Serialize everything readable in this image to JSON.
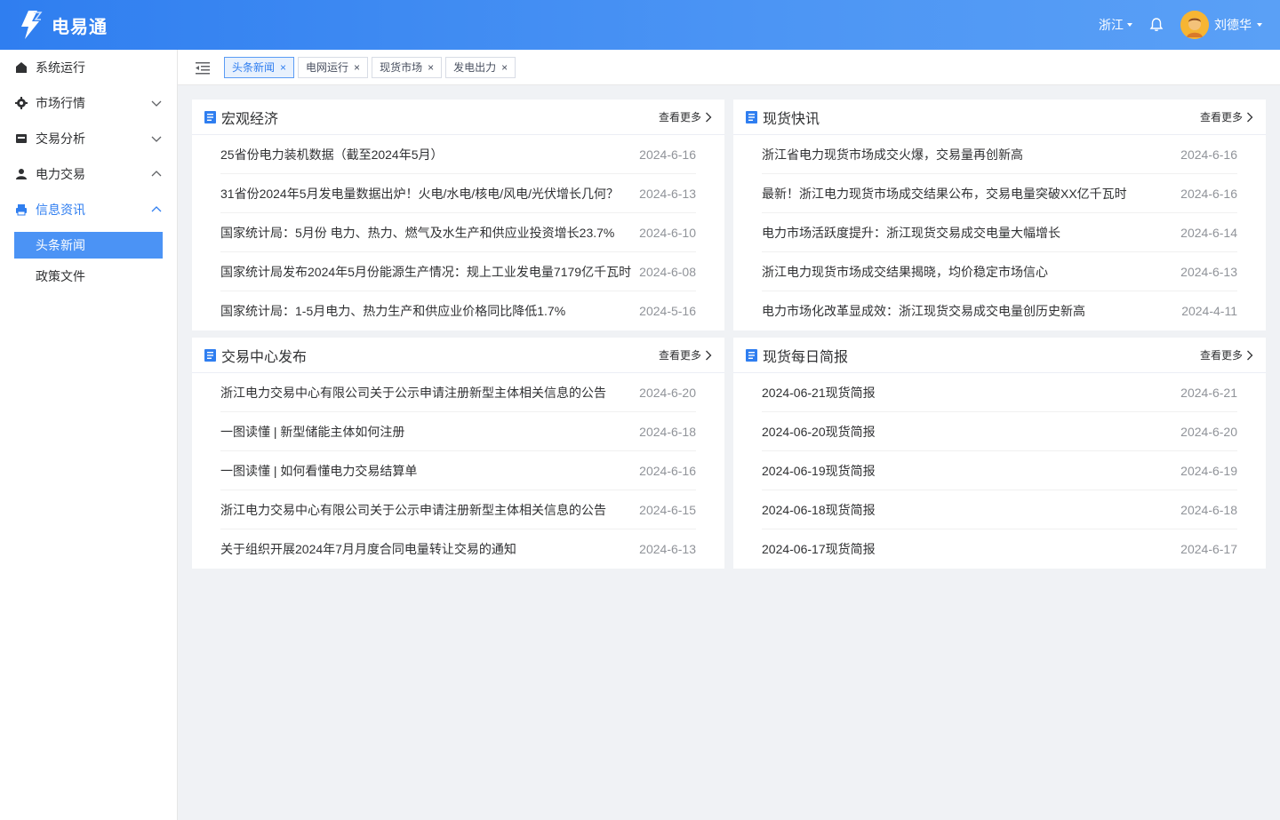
{
  "header": {
    "brand": "电易通",
    "region": "浙江",
    "user": "刘德华",
    "icons": {
      "logo": "lightning-logo",
      "bell": "bell-icon"
    }
  },
  "sidebar": {
    "items": [
      {
        "label": "系统运行",
        "icon": "home-icon"
      },
      {
        "label": "市场行情",
        "icon": "gear-icon"
      },
      {
        "label": "交易分析",
        "icon": "wallet-icon"
      },
      {
        "label": "电力交易",
        "icon": "user-icon"
      },
      {
        "label": "信息资讯",
        "icon": "printer-icon"
      }
    ],
    "subitems": [
      "头条新闻",
      "政策文件"
    ]
  },
  "tabs": [
    "头条新闻",
    "电网运行",
    "现货市场",
    "发电出力"
  ],
  "more_label": "查看更多",
  "cards": [
    {
      "title": "宏观经济",
      "rows": [
        {
          "title": "25省份电力装机数据（截至2024年5月）",
          "date": "2024-6-16"
        },
        {
          "title": "31省份2024年5月发电量数据出炉！火电/水电/核电/风电/光伏增长几何？",
          "date": "2024-6-13"
        },
        {
          "title": "国家统计局：5月份 电力、热力、燃气及水生产和供应业投资增长23.7%",
          "date": "2024-6-10"
        },
        {
          "title": "国家统计局发布2024年5月份能源生产情况：规上工业发电量7179亿千瓦时",
          "date": "2024-6-08"
        },
        {
          "title": "国家统计局：1-5月电力、热力生产和供应业价格同比降低1.7%",
          "date": "2024-5-16"
        }
      ]
    },
    {
      "title": "现货快讯",
      "rows": [
        {
          "title": "浙江省电力现货市场成交火爆，交易量再创新高",
          "date": "2024-6-16"
        },
        {
          "title": "最新！浙江电力现货市场成交结果公布，交易电量突破XX亿千瓦时",
          "date": "2024-6-16"
        },
        {
          "title": "电力市场活跃度提升：浙江现货交易成交电量大幅增长",
          "date": "2024-6-14"
        },
        {
          "title": "浙江电力现货市场成交结果揭晓，均价稳定市场信心",
          "date": "2024-6-13"
        },
        {
          "title": "电力市场化改革显成效：浙江现货交易成交电量创历史新高",
          "date": "2024-4-11"
        }
      ]
    },
    {
      "title": "交易中心发布",
      "rows": [
        {
          "title": "浙江电力交易中心有限公司关于公示申请注册新型主体相关信息的公告",
          "date": "2024-6-20"
        },
        {
          "title": "一图读懂 | 新型储能主体如何注册",
          "date": "2024-6-18"
        },
        {
          "title": "一图读懂 | 如何看懂电力交易结算单",
          "date": "2024-6-16"
        },
        {
          "title": "浙江电力交易中心有限公司关于公示申请注册新型主体相关信息的公告",
          "date": "2024-6-15"
        },
        {
          "title": "关于组织开展2024年7月月度合同电量转让交易的通知",
          "date": "2024-6-13"
        }
      ]
    },
    {
      "title": "现货每日简报",
      "rows": [
        {
          "title": "2024-06-21现货简报",
          "date": "2024-6-21"
        },
        {
          "title": "2024-06-20现货简报",
          "date": "2024-6-20"
        },
        {
          "title": "2024-06-19现货简报",
          "date": "2024-6-19"
        },
        {
          "title": "2024-06-18现货简报",
          "date": "2024-6-18"
        },
        {
          "title": "2024-06-17现货简报",
          "date": "2024-6-17"
        }
      ]
    }
  ],
  "colors": {
    "primary": "#2f7ef0",
    "active_sub": "#4b93f5",
    "date": "#909399"
  }
}
